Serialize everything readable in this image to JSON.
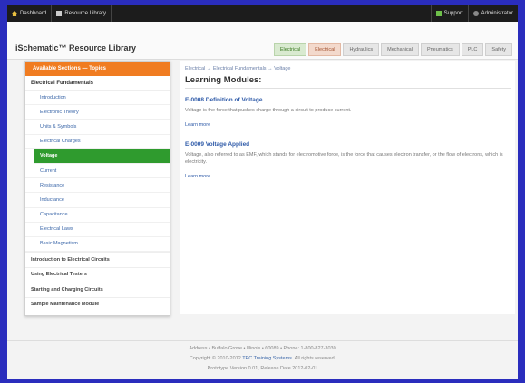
{
  "topbar": {
    "dashboard": "Dashboard",
    "resource_library": "Resource Library",
    "support": "Support",
    "user": "Administrator"
  },
  "header": {
    "brand": "iSchematic™ Resource Library",
    "tabs": [
      "Electrical",
      "Electrical",
      "Hydraulics",
      "Mechanical",
      "Pneumatics",
      "PLC",
      "Safety"
    ]
  },
  "sidebar": {
    "heading": "Available Sections — Topics",
    "section": "Electrical Fundamentals",
    "sub_items": [
      "Introduction",
      "Electronic Theory",
      "Units & Symbols",
      "Electrical Charges",
      "Voltage",
      "Current",
      "Resistance",
      "Inductance",
      "Capacitance",
      "Electrical Laws",
      "Basic Magnetism"
    ],
    "active_index": 4,
    "top_items": [
      "Introduction to Electrical Circuits",
      "Using Electrical Testers",
      "Starting and Charging Circuits",
      "Sample Maintenance Module"
    ]
  },
  "content": {
    "breadcrumb": "Electrical → Electrical Fundamentals → Voltage",
    "title": "Learning Modules:",
    "modules": [
      {
        "title": "E-0008 Definition of Voltage",
        "desc": "Voltage is the force that pushes charge through a circuit to produce current.",
        "more": "Learn more"
      },
      {
        "title": "E-0009 Voltage Applied",
        "desc": "Voltage, also referred to as EMF, which stands for electromotive force, is the force that causes electron transfer, or the flow of electrons, which is electricity.",
        "more": "Learn more"
      }
    ]
  },
  "footer": {
    "line1": "Address • Buffalo Grove • Illinois • 60089 • Phone: 1-800-827-3030",
    "line2_pre": "Copyright © 2010-2012",
    "line2_link": "TPC Training Systems",
    "line2_post": ". All rights reserved.",
    "line3": "Prototype Version 0.01, Release Date 2012-02-01"
  }
}
